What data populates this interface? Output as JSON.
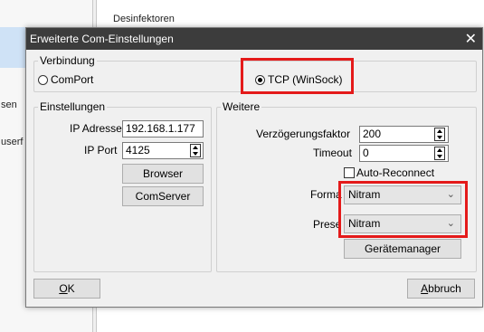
{
  "background": {
    "fragments": [
      "Desinfektoren",
      "sen",
      "userf"
    ]
  },
  "dialog": {
    "title": "Erweiterte Com-Einstellungen",
    "close_glyph": "✕",
    "verbindung": {
      "legend": "Verbindung",
      "comport_label": "ComPort",
      "tcp_label": "TCP (WinSock)",
      "selected": "tcp"
    },
    "einstellungen": {
      "legend": "Einstellungen",
      "ip_label": "IP Adresse",
      "ip_value": "192.168.1.177",
      "port_label": "IP Port",
      "port_value": "4125",
      "browser_button": "Browser",
      "comserver_button": "ComServer"
    },
    "weitere": {
      "legend": "Weitere",
      "delay_label": "Verzögerungsfaktor",
      "delay_value": "200",
      "timeout_label": "Timeout",
      "timeout_value": "0",
      "autoreconnect_label": "Auto-Reconnect",
      "format_label": "Forma",
      "format_value": "Nitram",
      "preset_label": "Prese",
      "preset_value": "Nitram",
      "geraetemanager_button": "Gerätemanager"
    },
    "ok_button": {
      "underlined": "O",
      "rest": "K"
    },
    "abbruch_button": {
      "underlined": "A",
      "rest": "bbruch"
    },
    "highlight_color": "#e41a1a"
  }
}
